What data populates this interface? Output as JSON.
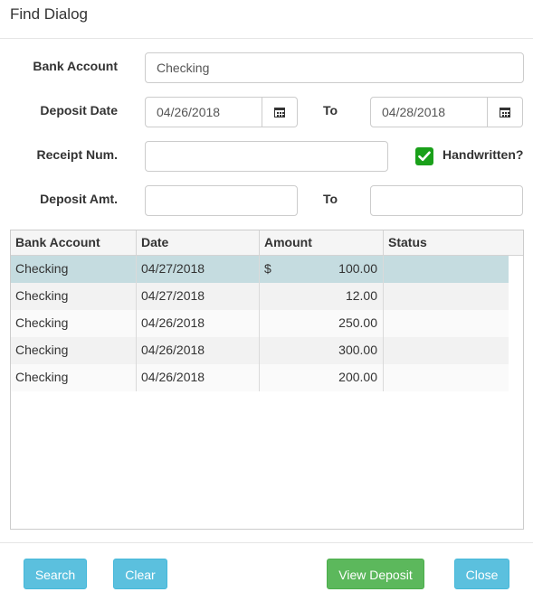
{
  "dialog": {
    "title": "Find Dialog"
  },
  "form": {
    "bank_account_label": "Bank Account",
    "bank_account_value": "Checking",
    "deposit_date_label": "Deposit Date",
    "deposit_date_from": "04/26/2018",
    "to_label": "To",
    "deposit_date_to": "04/28/2018",
    "receipt_num_label": "Receipt Num.",
    "receipt_num_value": "",
    "handwritten_label": "Handwritten?",
    "handwritten_checked": true,
    "deposit_amt_label": "Deposit Amt.",
    "deposit_amt_from": "",
    "deposit_amt_to": ""
  },
  "grid": {
    "columns": [
      "Bank Account",
      "Date",
      "Amount",
      "Status"
    ],
    "rows": [
      {
        "bank_account": "Checking",
        "date": "04/27/2018",
        "currency": "$",
        "amount": "100.00",
        "status": "",
        "selected": true
      },
      {
        "bank_account": "Checking",
        "date": "04/27/2018",
        "currency": "",
        "amount": "12.00",
        "status": "",
        "selected": false
      },
      {
        "bank_account": "Checking",
        "date": "04/26/2018",
        "currency": "",
        "amount": "250.00",
        "status": "",
        "selected": false
      },
      {
        "bank_account": "Checking",
        "date": "04/26/2018",
        "currency": "",
        "amount": "300.00",
        "status": "",
        "selected": false
      },
      {
        "bank_account": "Checking",
        "date": "04/26/2018",
        "currency": "",
        "amount": "200.00",
        "status": "",
        "selected": false
      }
    ]
  },
  "footer": {
    "search_label": "Search",
    "clear_label": "Clear",
    "view_deposit_label": "View Deposit",
    "close_label": "Close"
  },
  "icons": {
    "date_picker": "calendar-icon",
    "checkbox": "check-icon"
  },
  "colors": {
    "info_button": "#5bc0de",
    "success_button": "#5cb85c",
    "checkbox_checked": "#1aa01a",
    "selected_row": "#c5dce0"
  }
}
